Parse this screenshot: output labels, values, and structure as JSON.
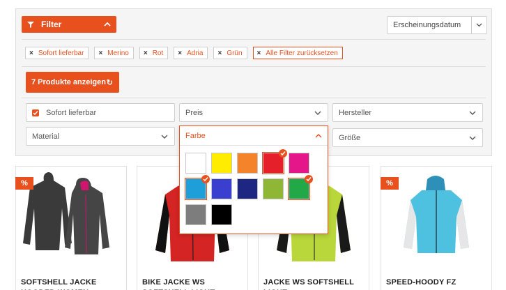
{
  "filter": {
    "toggle_label": "Filter",
    "sort": {
      "selected": "Erscheinungsdatum"
    },
    "active_tags": [
      "Sofort lieferbar",
      "Merino",
      "Rot",
      "Adria",
      "Grün"
    ],
    "reset_label": "Alle Filter zurücksetzen",
    "show_button": "7 Produkte anzeigen",
    "fields": {
      "instock": "Sofort lieferbar",
      "price": "Preis",
      "manufacturer": "Hersteller",
      "material": "Material",
      "color": "Farbe",
      "size": "Größe"
    },
    "colors": [
      {
        "name": "weiss",
        "hex": "#ffffff",
        "selected": false
      },
      {
        "name": "gelb",
        "hex": "#ffec00",
        "selected": false
      },
      {
        "name": "orange",
        "hex": "#f5832a",
        "selected": false
      },
      {
        "name": "rot",
        "hex": "#e5202a",
        "selected": true
      },
      {
        "name": "pink",
        "hex": "#e4168a",
        "selected": false
      },
      {
        "name": "adria",
        "hex": "#1f9fd9",
        "selected": true
      },
      {
        "name": "blau",
        "hex": "#3a3fd0",
        "selected": false
      },
      {
        "name": "dunkelblau",
        "hex": "#1d2680",
        "selected": false
      },
      {
        "name": "hellgruen",
        "hex": "#8fb634",
        "selected": false
      },
      {
        "name": "gruen",
        "hex": "#22a846",
        "selected": true
      },
      {
        "name": "grau",
        "hex": "#7d7d7d",
        "selected": false
      },
      {
        "name": "schwarz",
        "hex": "#000000",
        "selected": false
      }
    ]
  },
  "products": [
    {
      "title": "SOFTSHELL JACKE HOODED WOMEN",
      "badge": "%"
    },
    {
      "title": "BIKE JACKE WS SOFTSHELL LIGHT",
      "badge": ""
    },
    {
      "title": "JACKE WS SOFTSHELL LIGHT",
      "badge": "%"
    },
    {
      "title": "SPEED-HOODY FZ",
      "badge": "%"
    }
  ],
  "accent": "#e8501e"
}
